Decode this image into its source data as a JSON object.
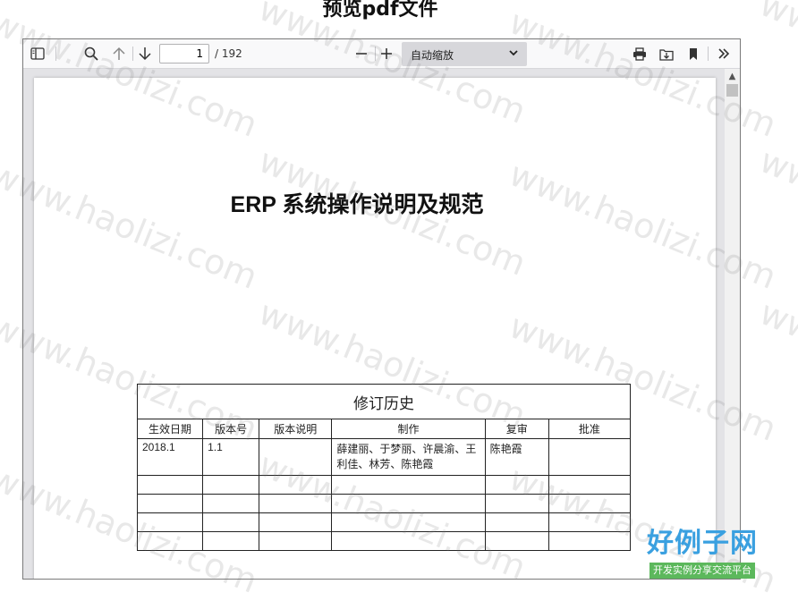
{
  "page": {
    "heading": "预览pdf文件"
  },
  "toolbar": {
    "page_number": "1",
    "page_count": "/ 192",
    "zoom_label": "自动缩放"
  },
  "document": {
    "title": "ERP 系统操作说明及规范",
    "revision_table": {
      "caption": "修订历史",
      "headers": [
        "生效日期",
        "版本号",
        "版本说明",
        "制作",
        "复审",
        "批准"
      ],
      "rows": [
        [
          "2018.1",
          "1.1",
          "",
          "薛建丽、于梦丽、许晨渝、王利佳、林芳、陈艳霞",
          "陈艳霞",
          ""
        ]
      ]
    }
  },
  "watermark": {
    "text": "www.haolizi.com"
  },
  "logo": {
    "main": "好例子网",
    "sub": "开发实例分享交流平台"
  }
}
